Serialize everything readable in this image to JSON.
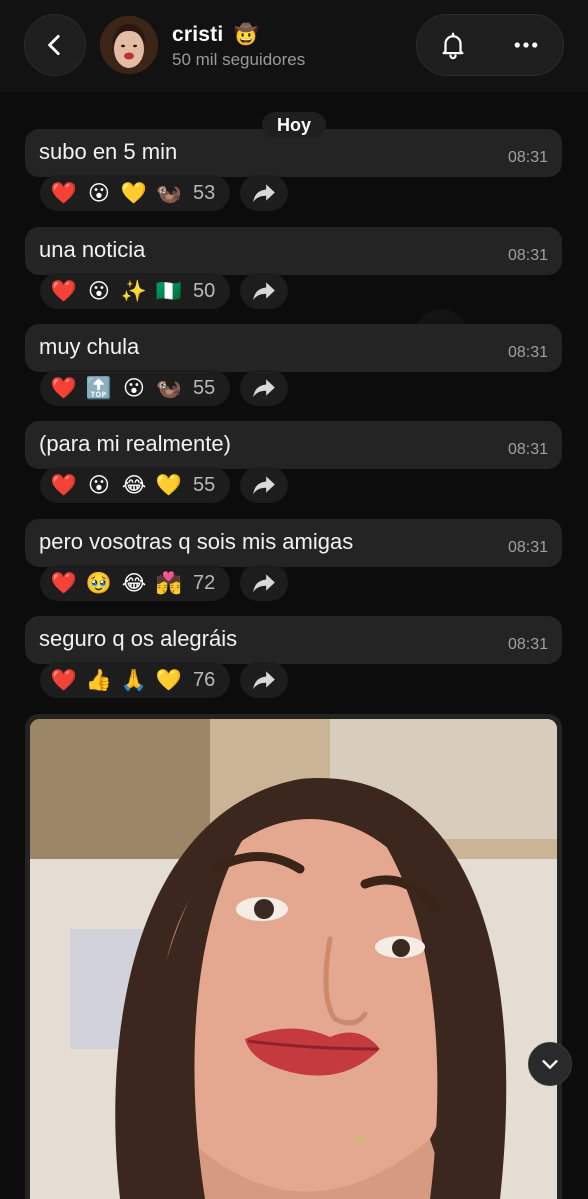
{
  "header": {
    "name": "cristi",
    "name_emoji": "🤠",
    "subtitle": "50 mil seguidores"
  },
  "date_separator": "Hoy",
  "messages": [
    {
      "text": "subo en 5 min",
      "time": "08:31",
      "reactions": [
        "❤️",
        "😮",
        "💛",
        "🦦"
      ],
      "count": "53"
    },
    {
      "text": "una noticia",
      "time": "08:31",
      "reactions": [
        "❤️",
        "😮",
        "✨",
        "🇳🇬"
      ],
      "count": "50"
    },
    {
      "text": "muy chula",
      "time": "08:31",
      "reactions": [
        "❤️",
        "🔝",
        "😮",
        "🦦"
      ],
      "count": "55"
    },
    {
      "text": "(para mi realmente)",
      "time": "08:31",
      "reactions": [
        "❤️",
        "😮",
        "😂",
        "💛"
      ],
      "count": "55"
    },
    {
      "text": "pero vosotras q sois mis amigas",
      "time": "08:31",
      "reactions": [
        "❤️",
        "🥹",
        "😂",
        "💏"
      ],
      "count": "72"
    },
    {
      "text": "seguro q os alegráis",
      "time": "08:31",
      "reactions": [
        "❤️",
        "👍",
        "🙏",
        "💛"
      ],
      "count": "76"
    }
  ],
  "icons": {
    "back": "chevron-left-icon",
    "bell": "bell-icon",
    "more": "more-horizontal-icon",
    "share": "forward-arrow-icon",
    "scroll_down": "chevron-down-icon"
  },
  "colors": {
    "background": "#0c0c0c",
    "bubble": "#242424",
    "subtitle": "#9a9a9a"
  }
}
